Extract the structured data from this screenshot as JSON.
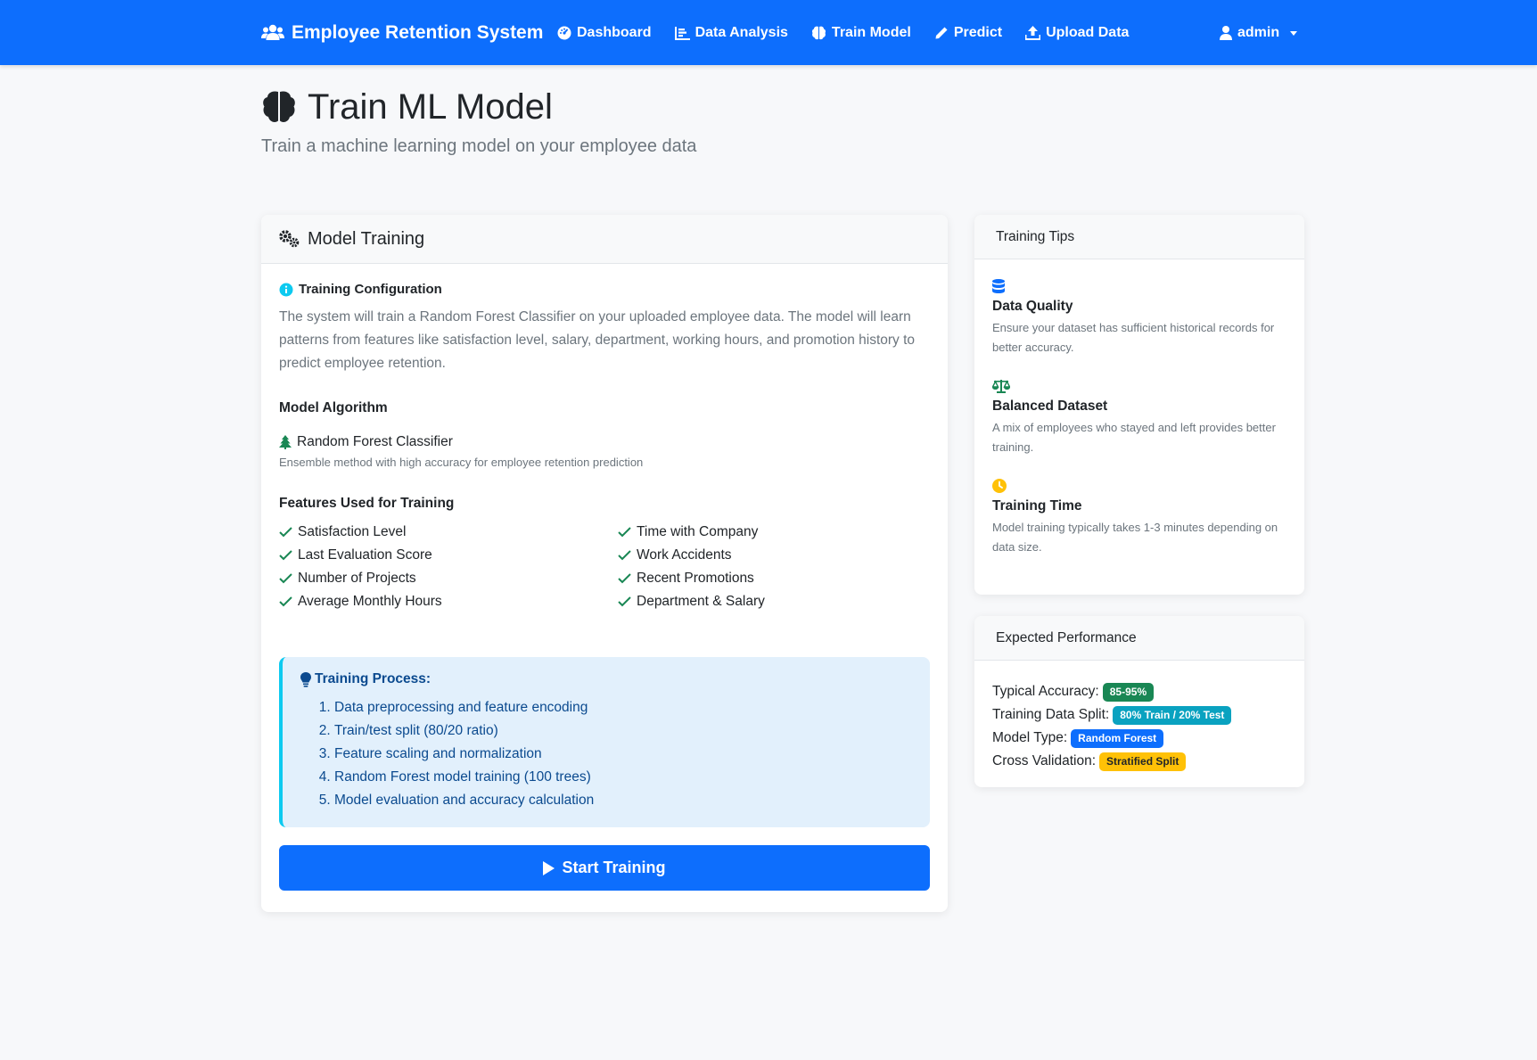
{
  "navbar": {
    "brand": "Employee Retention System",
    "links": [
      {
        "label": "Dashboard",
        "icon": "dashboard-icon"
      },
      {
        "label": "Data Analysis",
        "icon": "chart-icon"
      },
      {
        "label": "Train Model",
        "icon": "brain-icon"
      },
      {
        "label": "Predict",
        "icon": "pencil-icon"
      },
      {
        "label": "Upload Data",
        "icon": "upload-icon"
      }
    ],
    "user": "admin"
  },
  "header": {
    "title": "Train ML Model",
    "subtitle": "Train a machine learning model on your employee data"
  },
  "training_card": {
    "title": "Model Training",
    "config_heading": "Training Configuration",
    "config_text": "The system will train a Random Forest Classifier on your uploaded employee data. The model will learn patterns from features like satisfaction level, salary, department, working hours, and promotion history to predict employee retention.",
    "algorithm_heading": "Model Algorithm",
    "algorithm_name": "Random Forest Classifier",
    "algorithm_desc": "Ensemble method with high accuracy for employee retention prediction",
    "features_heading": "Features Used for Training",
    "features_left": [
      "Satisfaction Level",
      "Last Evaluation Score",
      "Number of Projects",
      "Average Monthly Hours"
    ],
    "features_right": [
      "Time with Company",
      "Work Accidents",
      "Recent Promotions",
      "Department & Salary"
    ],
    "process_heading": "Training Process:",
    "process_steps": [
      "Data preprocessing and feature encoding",
      "Train/test split (80/20 ratio)",
      "Feature scaling and normalization",
      "Random Forest model training (100 trees)",
      "Model evaluation and accuracy calculation"
    ],
    "start_button": "Start Training"
  },
  "tips_card": {
    "title": "Training Tips",
    "tips": [
      {
        "title": "Data Quality",
        "desc": "Ensure your dataset has sufficient historical records for better accuracy.",
        "icon": "database-icon",
        "color": "#0d6efd"
      },
      {
        "title": "Balanced Dataset",
        "desc": "A mix of employees who stayed and left provides better training.",
        "icon": "balance-scale-icon",
        "color": "#198754"
      },
      {
        "title": "Training Time",
        "desc": "Model training typically takes 1-3 minutes depending on data size.",
        "icon": "clock-icon",
        "color": "#ffc107"
      }
    ]
  },
  "performance_card": {
    "title": "Expected Performance",
    "rows": [
      {
        "label": "Typical Accuracy:",
        "value": "85-95%",
        "color": "#198754"
      },
      {
        "label": "Training Data Split:",
        "value": "80% Train / 20% Test",
        "color": "#0aa2c0"
      },
      {
        "label": "Model Type:",
        "value": "Random Forest",
        "color": "#0d6efd"
      },
      {
        "label": "Cross Validation:",
        "value": "Stratified Split",
        "color": "#ffc107"
      }
    ]
  },
  "colors": {
    "primary": "#0d6efd",
    "success": "#198754",
    "info": "#0dcaf0",
    "warning": "#ffc107"
  }
}
